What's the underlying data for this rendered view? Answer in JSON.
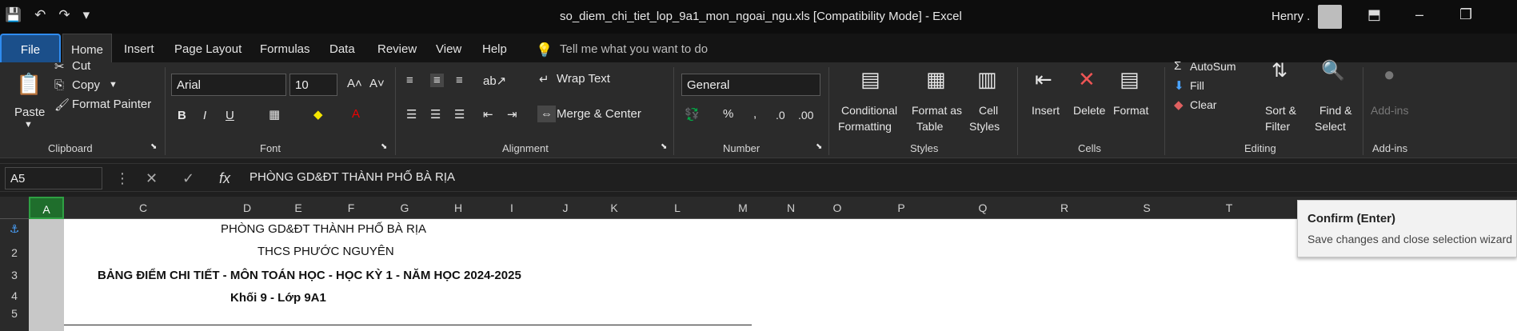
{
  "titlebar": {
    "title": "so_diem_chi_tiet_lop_9a1_mon_ngoai_ngu.xls  [Compatibility Mode]  -  Excel",
    "user": "Henry ."
  },
  "tabs": [
    "File",
    "Home",
    "Insert",
    "Page Layout",
    "Formulas",
    "Data",
    "Review",
    "View",
    "Help"
  ],
  "tell_me": "Tell me what you want to do",
  "clipboard": {
    "paste": "Paste",
    "cut": "Cut",
    "copy": "Copy",
    "format_painter": "Format Painter",
    "label": "Clipboard"
  },
  "font": {
    "name": "Arial",
    "size": "10",
    "label": "Font"
  },
  "alignment": {
    "wrap": "Wrap Text",
    "merge": "Merge & Center",
    "label": "Alignment"
  },
  "number": {
    "format": "General",
    "label": "Number"
  },
  "styles": {
    "conditional": "Conditional",
    "formatting": "Formatting",
    "format_as": "Format as",
    "table": "Table",
    "cell": "Cell",
    "styles_lbl": "Styles",
    "label": "Styles"
  },
  "cells": {
    "insert": "Insert",
    "delete": "Delete",
    "format": "Format",
    "label": "Cells"
  },
  "editing": {
    "autosum": "AutoSum",
    "fill": "Fill",
    "clear": "Clear",
    "sort": "Sort &",
    "filter": "Filter",
    "find": "Find &",
    "select": "Select",
    "label": "Editing"
  },
  "addins": {
    "addins": "Add-ins",
    "label": "Add-ins"
  },
  "formula_bar": {
    "name_box": "A5",
    "formula": "PHÒNG GD&ĐT THÀNH PHỐ BÀ RỊA"
  },
  "columns": [
    "A",
    "C",
    "D",
    "E",
    "F",
    "G",
    "H",
    "I",
    "J",
    "K",
    "L",
    "M",
    "N",
    "O",
    "P",
    "Q",
    "R",
    "S",
    "T"
  ],
  "rows": [
    "2",
    "3",
    "4",
    "5"
  ],
  "sheet": {
    "r1": "PHÒNG GD&ĐT THÀNH PHỐ BÀ RỊA",
    "r2": "THCS PHƯỚC NGUYÊN",
    "r3": "BẢNG ĐIỂM CHI TIẾT - MÔN TOÁN HỌC - HỌC KỲ 1 - NĂM HỌC 2024-2025",
    "r4": "Khối 9 - Lớp 9A1"
  },
  "tooltip": {
    "title": "Confirm (Enter)",
    "desc": "Save changes and close selection wizard"
  }
}
